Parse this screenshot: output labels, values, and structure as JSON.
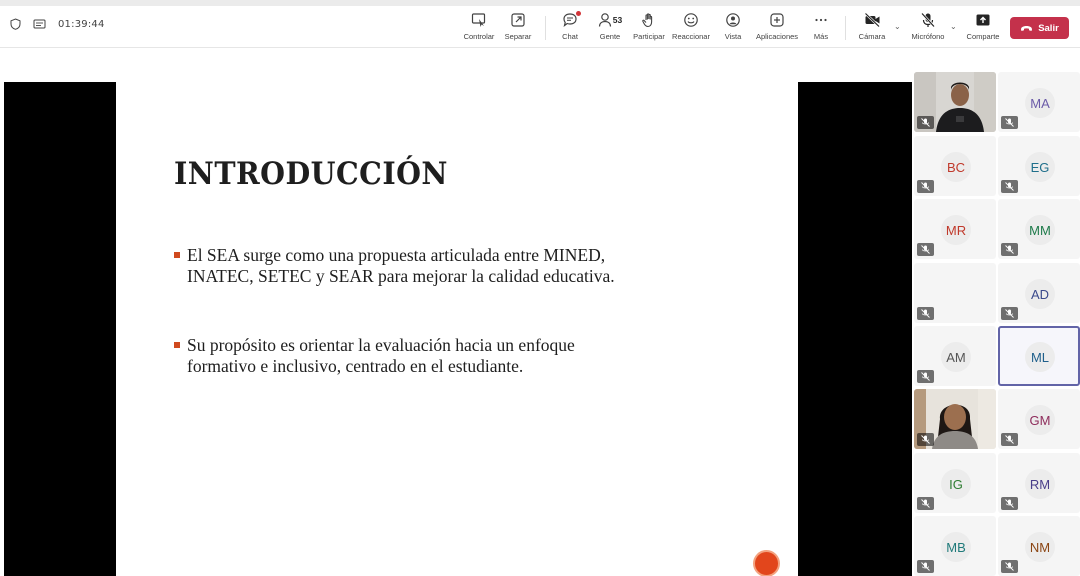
{
  "header": {
    "timer": "01:39:44"
  },
  "toolbar": {
    "controlar": "Controlar",
    "separar": "Separar",
    "chat": "Chat",
    "gente": "Gente",
    "gente_count": "53",
    "participar": "Participar",
    "reaccionar": "Reaccionar",
    "vista": "Vista",
    "aplicaciones": "Aplicaciones",
    "mas": "Más",
    "camara": "Cámara",
    "microfono": "Micrófono",
    "compartir": "Comparte",
    "salir": "Salir",
    "salir_color": "#c4314b"
  },
  "slide": {
    "title": "INTRODUCCIÓN",
    "bullets": [
      {
        "line1": "El SEA surge como una propuesta articulada entre MINED,",
        "line2": "INATEC, SETEC y SEAR para mejorar la calidad educativa."
      },
      {
        "line1": "Su propósito es orientar la evaluación hacia un enfoque",
        "line2": "formativo e inclusivo, centrado en el estudiante."
      }
    ],
    "bullet_color": "#d04a1e"
  },
  "participants": [
    {
      "initials": "",
      "video": true
    },
    {
      "initials": "MA",
      "color": "#6b5ba8"
    },
    {
      "initials": "BC",
      "color": "#c0392b"
    },
    {
      "initials": "EG",
      "color": "#1f6f8b"
    },
    {
      "initials": "MR",
      "color": "#c0392b"
    },
    {
      "initials": "MM",
      "color": "#1e7a4a"
    },
    {
      "initials": "",
      "blank": true
    },
    {
      "initials": "AD",
      "color": "#3b4a8c"
    },
    {
      "initials": "AM",
      "color": "#555555"
    },
    {
      "initials": "ML",
      "color": "#1f5f8b",
      "selected": true
    },
    {
      "initials": "",
      "video": true
    },
    {
      "initials": "GM",
      "color": "#8e2d5c"
    },
    {
      "initials": "IG",
      "color": "#2e7d32"
    },
    {
      "initials": "RM",
      "color": "#4a3f8a"
    },
    {
      "initials": "MB",
      "color": "#1f7a7a"
    },
    {
      "initials": "NM",
      "color": "#8b4513"
    }
  ]
}
